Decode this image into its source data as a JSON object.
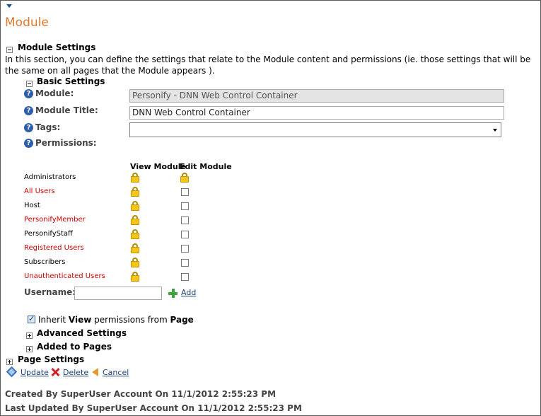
{
  "page": {
    "title": "Module"
  },
  "module_settings": {
    "header": "Module Settings",
    "description": "In this section, you can define the settings that relate to the Module content and permissions (ie. those settings that will be the same on all pages that the Module appears )."
  },
  "basic_settings": {
    "header": "Basic Settings",
    "module_label": "Module:",
    "module_value": "Personify - DNN Web Control Container",
    "title_label": "Module Title:",
    "title_value": "DNN Web Control Container",
    "tags_label": "Tags:",
    "permissions_label": "Permissions:"
  },
  "permissions": {
    "col_view": "View Module",
    "col_edit": "Edit Module",
    "roles": [
      {
        "name": "Administrators",
        "color": "#000000"
      },
      {
        "name": "All Users",
        "color": "#cc0000"
      },
      {
        "name": "Host",
        "color": "#000000"
      },
      {
        "name": "PersonifyMember",
        "color": "#cc0000"
      },
      {
        "name": "PersonifyStaff",
        "color": "#000000"
      },
      {
        "name": "Registered Users",
        "color": "#cc0000"
      },
      {
        "name": "Subscribers",
        "color": "#000000"
      },
      {
        "name": "Unauthenticated Users",
        "color": "#cc0000"
      }
    ],
    "username_label": "Username:",
    "username_value": "",
    "add_label": "Add",
    "inherit_prefix": "Inherit ",
    "inherit_view": "View",
    "inherit_middle": " permissions from ",
    "inherit_page": "Page"
  },
  "collapsed_sections": {
    "advanced": "Advanced Settings",
    "added_to_pages": "Added to Pages",
    "page_settings": "Page Settings"
  },
  "actions": {
    "update": "Update",
    "delete": "Delete",
    "cancel": "Cancel"
  },
  "audit": {
    "created": "Created By SuperUser Account On 11/1/2012 2:55:23 PM",
    "updated": "Last Updated By SuperUser Account On 11/1/2012 2:55:23 PM"
  },
  "icons": {
    "help": "help-icon",
    "lock": "lock-icon",
    "add": "plus-icon",
    "update": "update-icon",
    "delete": "delete-icon",
    "cancel": "cancel-icon"
  },
  "colors": {
    "title": "#e07a2e",
    "link": "#1f3f75",
    "role_highlight": "#cc0000"
  }
}
